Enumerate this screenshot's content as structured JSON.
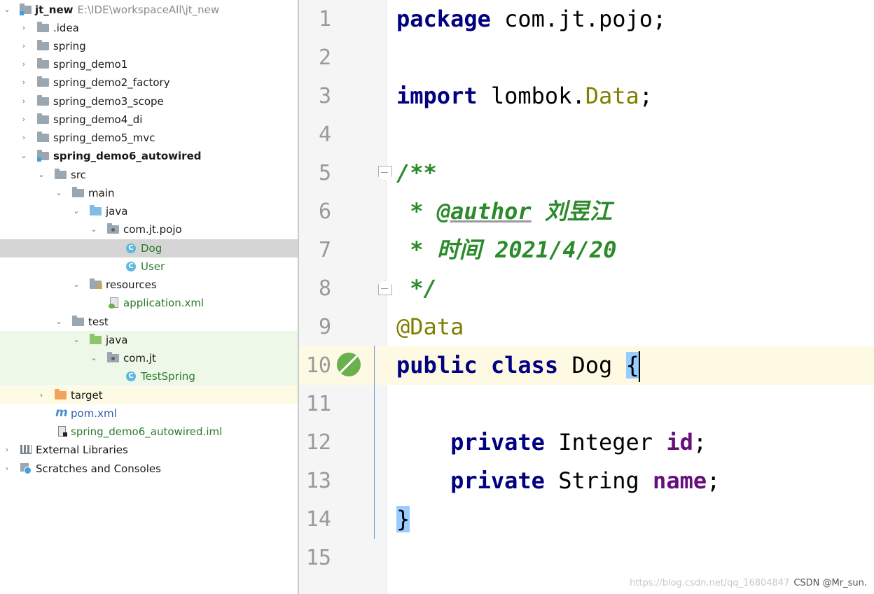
{
  "project_tree": {
    "nodes": [
      {
        "label": "jt_new",
        "path": "E:\\IDE\\workspaceAll\\jt_new",
        "icon": "module-folder-icon"
      },
      {
        "label": ".idea",
        "icon": "folder-icon"
      },
      {
        "label": "spring",
        "icon": "folder-icon"
      },
      {
        "label": "spring_demo1",
        "icon": "folder-icon"
      },
      {
        "label": "spring_demo2_factory",
        "icon": "folder-icon"
      },
      {
        "label": "spring_demo3_scope",
        "icon": "folder-icon"
      },
      {
        "label": "spring_demo4_di",
        "icon": "folder-icon"
      },
      {
        "label": "spring_demo5_mvc",
        "icon": "folder-icon"
      },
      {
        "label": "spring_demo6_autowired",
        "icon": "module-folder-icon"
      },
      {
        "label": "src",
        "icon": "folder-icon"
      },
      {
        "label": "main",
        "icon": "folder-icon"
      },
      {
        "label": "java",
        "icon": "source-folder-icon"
      },
      {
        "label": "com.jt.pojo",
        "icon": "package-icon"
      },
      {
        "label": "Dog",
        "icon": "class-icon"
      },
      {
        "label": "User",
        "icon": "class-icon"
      },
      {
        "label": "resources",
        "icon": "resources-folder-icon"
      },
      {
        "label": "application.xml",
        "icon": "spring-xml-icon"
      },
      {
        "label": "test",
        "icon": "folder-icon"
      },
      {
        "label": "java",
        "icon": "test-folder-icon"
      },
      {
        "label": "com.jt",
        "icon": "package-icon"
      },
      {
        "label": "TestSpring",
        "icon": "test-class-icon"
      },
      {
        "label": "target",
        "icon": "excluded-folder-icon"
      },
      {
        "label": "pom.xml",
        "icon": "maven-icon"
      },
      {
        "label": "spring_demo6_autowired.iml",
        "icon": "iml-file-icon"
      },
      {
        "label": "External Libraries",
        "icon": "libraries-icon"
      },
      {
        "label": "Scratches and Consoles",
        "icon": "scratches-icon"
      }
    ]
  },
  "editor": {
    "line_numbers": [
      "1",
      "2",
      "3",
      "4",
      "5",
      "6",
      "7",
      "8",
      "9",
      "10",
      "11",
      "12",
      "13",
      "14",
      "15"
    ],
    "code": {
      "l1_kw": "package",
      "l1_rest": " com.jt.pojo;",
      "l3_kw": "import",
      "l3_pre": " lombok.",
      "l3_cls": "Data",
      "l3_end": ";",
      "l5": "/**",
      "l6_star": " * ",
      "l6_tag": "@author",
      "l6_text": " 刘昱江",
      "l7": " * 时间 2021/4/20",
      "l8": " */",
      "l9": "@Data",
      "l10_kw": "public class",
      "l10_name": " Dog ",
      "l10_brace": "{",
      "l12_indent": "    ",
      "l12_kw": "private",
      "l12_type": " Integer ",
      "l12_field": "id",
      "l12_end": ";",
      "l13_indent": "    ",
      "l13_kw": "private",
      "l13_type": " String ",
      "l13_field": "name",
      "l13_end": ";",
      "l14_brace": "}"
    }
  },
  "watermark": {
    "text": "https://blog.csdn.net/qq_16804847",
    "csdn": "CSDN @Mr_sun."
  }
}
